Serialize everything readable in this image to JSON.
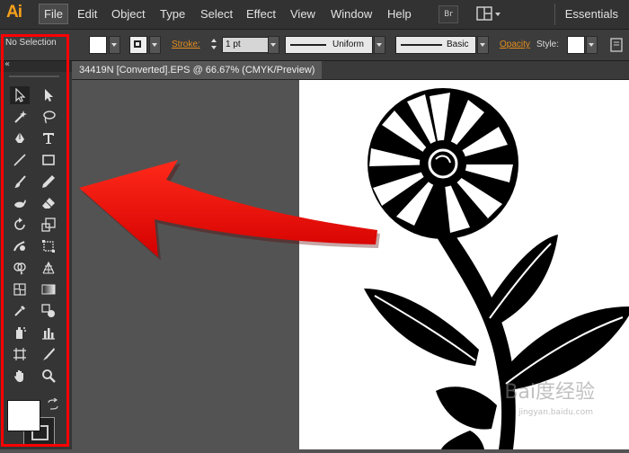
{
  "app": {
    "logo": "Ai"
  },
  "menu": {
    "items": [
      {
        "key": "file",
        "label": "File"
      },
      {
        "key": "edit",
        "label": "Edit"
      },
      {
        "key": "object",
        "label": "Object"
      },
      {
        "key": "type",
        "label": "Type"
      },
      {
        "key": "select",
        "label": "Select"
      },
      {
        "key": "effect",
        "label": "Effect"
      },
      {
        "key": "view",
        "label": "View"
      },
      {
        "key": "window",
        "label": "Window"
      },
      {
        "key": "help",
        "label": "Help"
      }
    ],
    "bridge_label": "Br",
    "workspace": "Essentials"
  },
  "control_bar": {
    "selection_text": "No Selection",
    "stroke_label": "Stroke:",
    "stroke_weight": "1 pt",
    "stroke_profile": "Uniform",
    "brush": "Basic",
    "opacity_label": "Opacity",
    "style_label": "Style:"
  },
  "document": {
    "tab_title": "34419N [Converted].EPS @ 66.67% (CMYK/Preview)"
  },
  "tools_panel": {
    "collapse_glyph": "«",
    "tools": [
      "selection",
      "direct-selection",
      "magic-wand",
      "lasso",
      "pen",
      "type",
      "line-segment",
      "rectangle",
      "paintbrush",
      "pencil",
      "blob-brush",
      "eraser",
      "rotate",
      "scale",
      "warp",
      "free-transform",
      "shape-builder",
      "perspective-grid",
      "mesh",
      "gradient",
      "eyedropper",
      "blend",
      "symbol-sprayer",
      "column-graph",
      "artboard",
      "slice",
      "hand",
      "zoom"
    ]
  },
  "watermark": {
    "text": "Bai度经验",
    "url": "jingyan.baidu.com"
  },
  "colors": {
    "accent": "#f7a11a",
    "annotation": "#ff0000",
    "opacity_link": "#e38e1e"
  }
}
